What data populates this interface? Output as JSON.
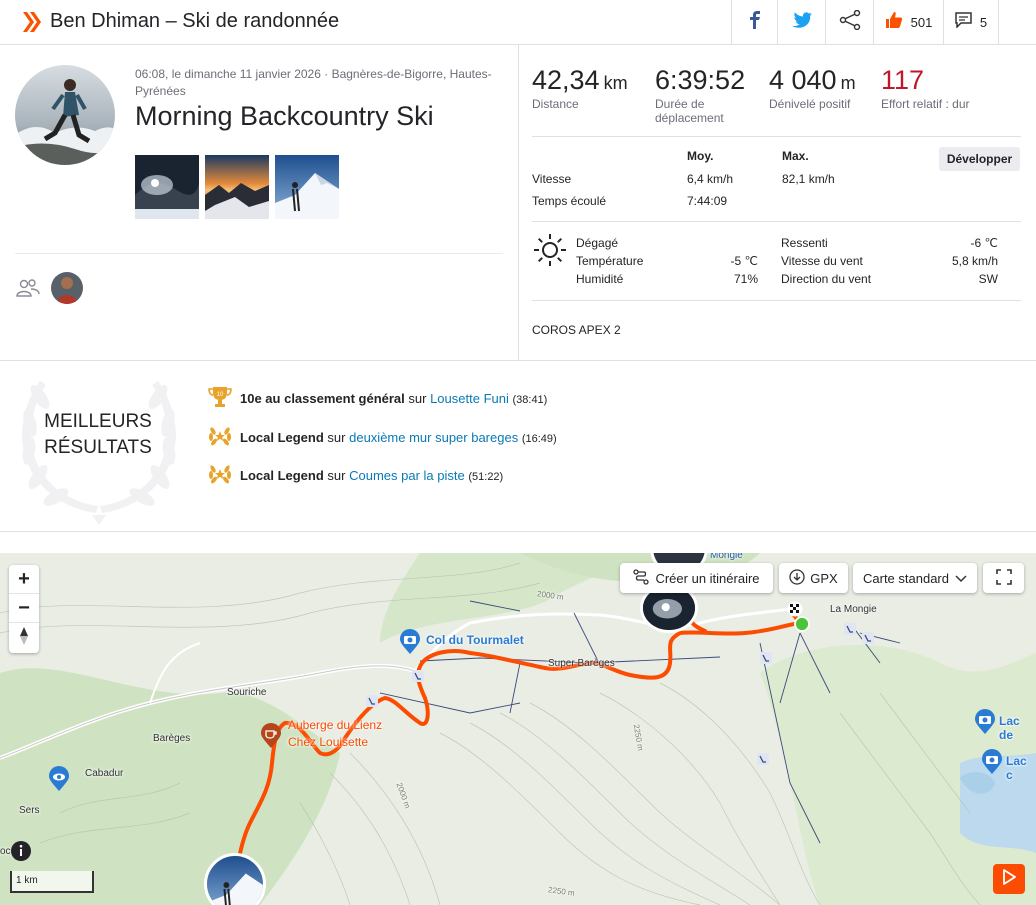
{
  "header": {
    "title": "Ben Dhiman – Ski de randonnée",
    "kudos_count": "501",
    "comments_count": "5"
  },
  "activity": {
    "meta": "06:08, le dimanche 11 janvier 2026 · Bagnères-de-Bigorre, Hautes-Pyrénées",
    "name": "Morning Backcountry Ski"
  },
  "stats": {
    "distance_value": "42,34",
    "distance_unit": "km",
    "distance_label": "Distance",
    "moving_time_value": "6:39:52",
    "moving_time_label": "Durée de déplacement",
    "elevation_value": "4 040",
    "elevation_unit": "m",
    "elevation_label": "Dénivelé positif",
    "effort_value": "117",
    "effort_label": "Effort relatif : dur",
    "col_avg": "Moy.",
    "col_max": "Max.",
    "expand_button": "Développer",
    "speed_label": "Vitesse",
    "speed_avg": "6,4 km/h",
    "speed_max": "82,1 km/h",
    "elapsed_label": "Temps écoulé",
    "elapsed_value": "7:44:09"
  },
  "weather": {
    "condition": "Dégagé",
    "temp_label": "Température",
    "temp_value": "-5 ℃",
    "humidity_label": "Humidité",
    "humidity_value": "71%",
    "feels_label": "Ressenti",
    "feels_value": "-6 ℃",
    "wind_speed_label": "Vitesse du vent",
    "wind_speed_value": "5,8 km/h",
    "wind_dir_label": "Direction du vent",
    "wind_dir_value": "SW"
  },
  "device": "COROS APEX 2",
  "best_results": {
    "title_line1": "MEILLEURS",
    "title_line2": "RÉSULTATS",
    "items": [
      {
        "strong": "10e au classement général",
        "sep": "sur",
        "segment": "Lousette Funi",
        "time": "(38:41)",
        "icon": "trophy-icon"
      },
      {
        "strong": "Local Legend",
        "sep": "sur",
        "segment": "deuxième mur super bareges",
        "time": "(16:49)",
        "icon": "laurel-icon"
      },
      {
        "strong": "Local Legend",
        "sep": "sur",
        "segment": "Coumes par la piste",
        "time": "(51:22)",
        "icon": "laurel-icon"
      }
    ],
    "trophy_rank": "10"
  },
  "map": {
    "zoom_in": "+",
    "zoom_out": "−",
    "create_route": "Créer un itinéraire",
    "gpx": "GPX",
    "map_style": "Carte standard",
    "scale": "1 km",
    "places": {
      "mongie_top": "Mongie",
      "la_mongie": "La Mongie",
      "col_tourmalet": "Col du Tourmalet",
      "super_bareges": "Super Barèges",
      "souriche": "Souriche",
      "bareges": "Barèges",
      "auberge": "Auberge du Lienz",
      "chez_louisette": "Chez Louisette",
      "cabadur": "Cabadur",
      "sers": "Sers",
      "lac1": "Lac de",
      "lac2": "Lac c",
      "c_label": "oc",
      "contour_2000": "2000 m",
      "contour_2250": "2250 m",
      "contour_2000b": "2000 m",
      "contour_2250b": "2250 m"
    }
  },
  "colors": {
    "brand": "#fc5200",
    "link": "#0a79b5",
    "effort": "#c0172b",
    "route": "#fc4c02"
  }
}
